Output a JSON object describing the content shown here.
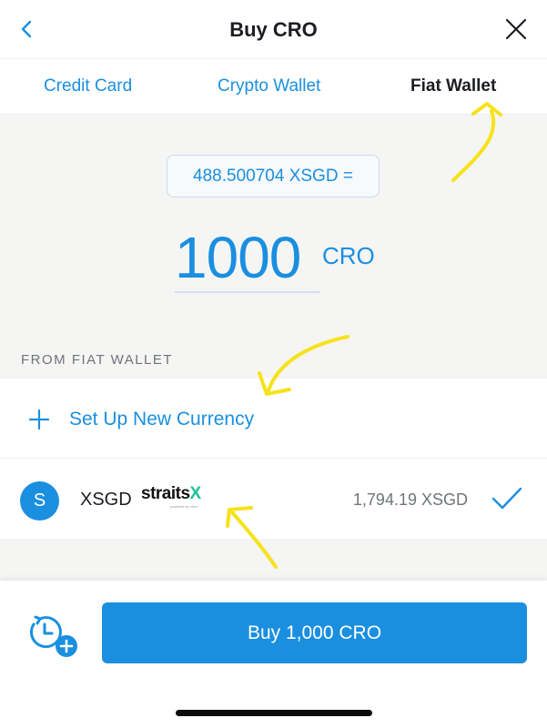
{
  "header": {
    "title": "Buy CRO",
    "back_icon": "chevron-left-icon",
    "close_icon": "close-icon"
  },
  "tabs": [
    {
      "label": "Credit Card",
      "active": false
    },
    {
      "label": "Crypto Wallet",
      "active": false
    },
    {
      "label": "Fiat Wallet",
      "active": true
    }
  ],
  "conversion": {
    "rate_text": "488.500704 XSGD =",
    "amount": "1000",
    "unit": "CRO"
  },
  "source": {
    "section_label": "FROM FIAT WALLET",
    "setup_label": "Set Up New Currency",
    "wallets": [
      {
        "avatar_letter": "S",
        "currency": "XSGD",
        "brand_name": "straits",
        "brand_suffix": "X",
        "brand_subtext": "powered by xfers",
        "balance": "1,794.19 XSGD",
        "selected": true
      }
    ]
  },
  "footer": {
    "recurring_icon": "recurring-clock-add-icon",
    "buy_label": "Buy 1,000 CRO"
  },
  "colors": {
    "accent": "#1a8fe0",
    "annotation": "#f6e21a",
    "brand_green": "#1fc29b",
    "background": "#f5f5f4"
  }
}
